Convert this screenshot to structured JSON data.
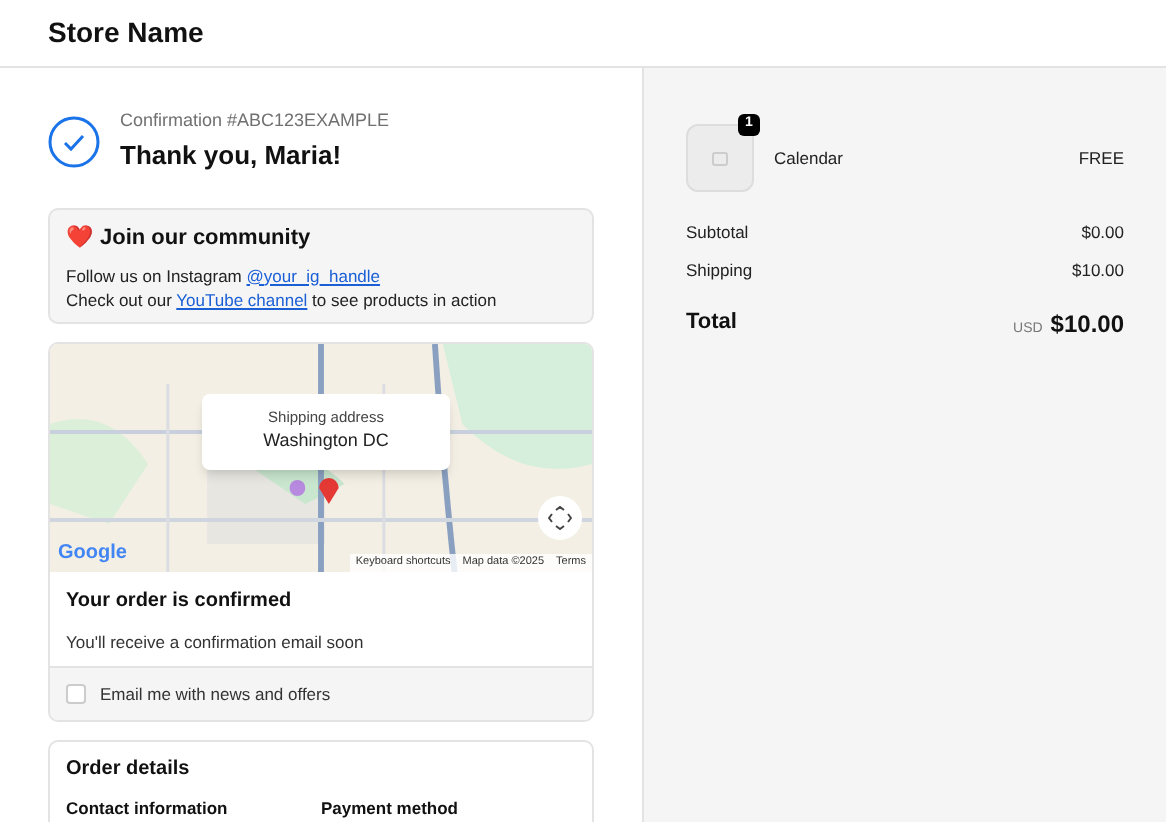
{
  "header": {
    "store_name": "Store Name"
  },
  "confirmation": {
    "number": "Confirmation #ABC123EXAMPLE",
    "title": "Thank you, Maria!"
  },
  "community": {
    "emoji": "❤️",
    "title": "Join our community",
    "lines": [
      {
        "text": "Follow us on Instagram",
        "link": "@your_ig_handle"
      },
      {
        "text": "Check out our",
        "link": "YouTube channel",
        "after": "to see products in action"
      }
    ]
  },
  "map": {
    "popup_label": "Shipping address",
    "popup_value": "Washington DC",
    "logo": "Google",
    "attribution": [
      "Keyboard shortcuts",
      "Map data ©2025",
      "Terms"
    ]
  },
  "order_status": {
    "title": "Your order is confirmed",
    "text": "You'll receive a confirmation email soon",
    "newsletter": {
      "label": "Email me with news and offers",
      "checked": false
    }
  },
  "order_details": {
    "title": "Order details",
    "columns": [
      "Contact information",
      "Payment method"
    ]
  },
  "summary": {
    "items": [
      {
        "name": "Calendar",
        "quantity": "1",
        "price": "FREE"
      }
    ],
    "lines": [
      {
        "label": "Subtotal",
        "value": "$0.00"
      },
      {
        "label": "Shipping",
        "value": "$10.00"
      }
    ],
    "total": {
      "label": "Total",
      "currency": "USD",
      "value": "$10.00"
    }
  }
}
